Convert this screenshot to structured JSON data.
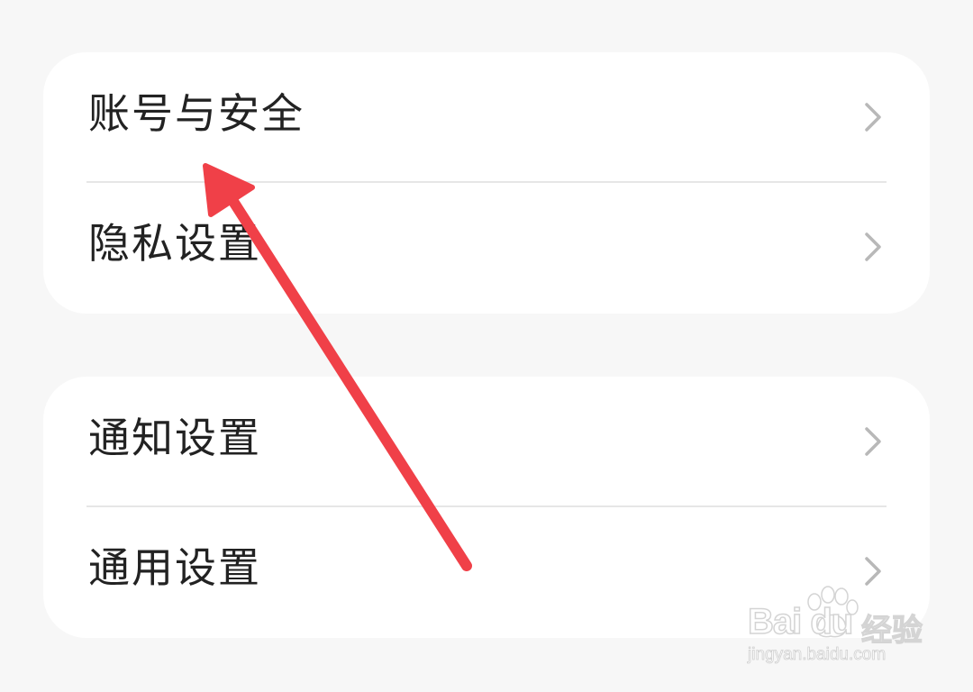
{
  "settings": {
    "groups": [
      {
        "items": [
          {
            "label": "账号与安全",
            "icon": "chevron-right-icon"
          },
          {
            "label": "隐私设置",
            "icon": "chevron-right-icon"
          }
        ]
      },
      {
        "items": [
          {
            "label": "通知设置",
            "icon": "chevron-right-icon"
          },
          {
            "label": "通用设置",
            "icon": "chevron-right-icon"
          }
        ]
      }
    ]
  },
  "annotation": {
    "type": "arrow",
    "color": "#f04048",
    "points_to": "账号与安全"
  },
  "watermark": {
    "brand": "Bai du",
    "zh": "经验",
    "url": "jingyan.baidu.com"
  },
  "colors": {
    "background": "#f7f7f7",
    "card": "#ffffff",
    "text": "#222222",
    "chevron": "#b8b8b8",
    "divider": "#e6e6e6"
  }
}
